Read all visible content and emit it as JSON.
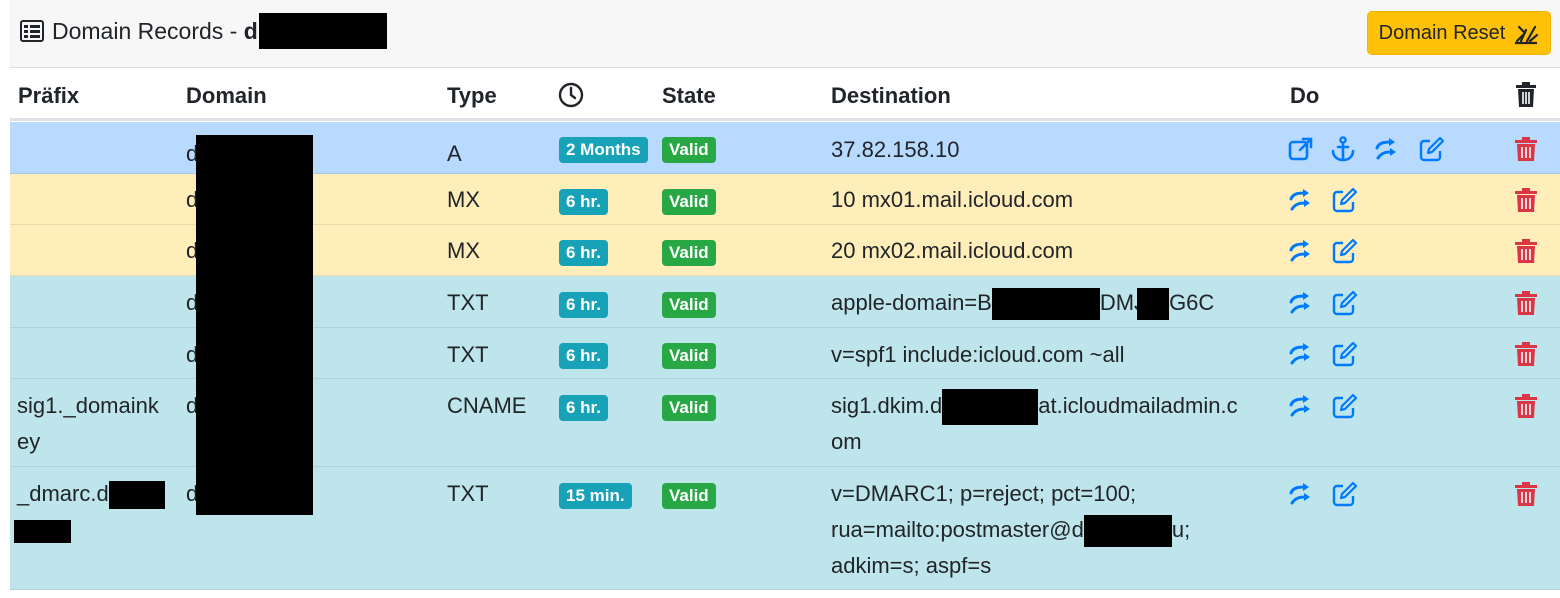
{
  "header": {
    "title_prefix": "Domain Records - ",
    "title_bold": "d",
    "reset_label": "Domain Reset"
  },
  "columns": {
    "prefix": "Präfix",
    "domain": "Domain",
    "type": "Type",
    "state": "State",
    "destination": "Destination",
    "do": "Do"
  },
  "colors": {
    "primary_row": "#b8daff",
    "warning_row": "#ffeeba",
    "info_row": "#bee5eb",
    "ttl_badge": "#17a2b8",
    "valid_badge": "#28a745",
    "action_blue": "#007bff",
    "delete_red": "#dc3545",
    "reset_button": "#ffc107"
  },
  "rows": [
    {
      "prefix": "",
      "domain": "d",
      "type": "A",
      "ttl": "2 Months",
      "state": "Valid",
      "dest": [
        "37.82.158.10"
      ],
      "actions": [
        "external-link-icon",
        "anchor-icon",
        "share-icon",
        "edit-icon"
      ],
      "color": "primary"
    },
    {
      "prefix": "",
      "domain": "d",
      "type": "MX",
      "ttl": "6 hr.",
      "state": "Valid",
      "dest": [
        "10 mx01.mail.icloud.com"
      ],
      "actions": [
        "share-icon",
        "edit-icon"
      ],
      "color": "warning"
    },
    {
      "prefix": "",
      "domain": "d",
      "type": "MX",
      "ttl": "6 hr.",
      "state": "Valid",
      "dest": [
        "20 mx02.mail.icloud.com"
      ],
      "actions": [
        "share-icon",
        "edit-icon"
      ],
      "color": "warning"
    },
    {
      "prefix": "",
      "domain": "d",
      "type": "TXT",
      "ttl": "6 hr.",
      "state": "Valid",
      "dest": [
        "apple-domain=B",
        "DMJ",
        "G6C"
      ],
      "actions": [
        "share-icon",
        "edit-icon"
      ],
      "color": "info"
    },
    {
      "prefix": "",
      "domain": "d",
      "type": "TXT",
      "ttl": "6 hr.",
      "state": "Valid",
      "dest": [
        "v=spf1 include:icloud.com ~all"
      ],
      "actions": [
        "share-icon",
        "edit-icon"
      ],
      "color": "info"
    },
    {
      "prefix": [
        "sig1._domaink",
        "ey"
      ],
      "domain": "d",
      "type": "CNAME",
      "ttl": "6 hr.",
      "state": "Valid",
      "dest": [
        "sig1.dkim.d",
        "at.icloudmailadmin.c",
        "om"
      ],
      "actions": [
        "share-icon",
        "edit-icon"
      ],
      "color": "info"
    },
    {
      "prefix": [
        "_dmarc.d"
      ],
      "domain": "d",
      "type": "TXT",
      "ttl": "15 min.",
      "state": "Valid",
      "dest": [
        "v=DMARC1; p=reject; pct=100;",
        "rua=mailto:postmaster@d",
        "u;",
        "adkim=s; aspf=s"
      ],
      "actions": [
        "share-icon",
        "edit-icon"
      ],
      "color": "info"
    }
  ]
}
